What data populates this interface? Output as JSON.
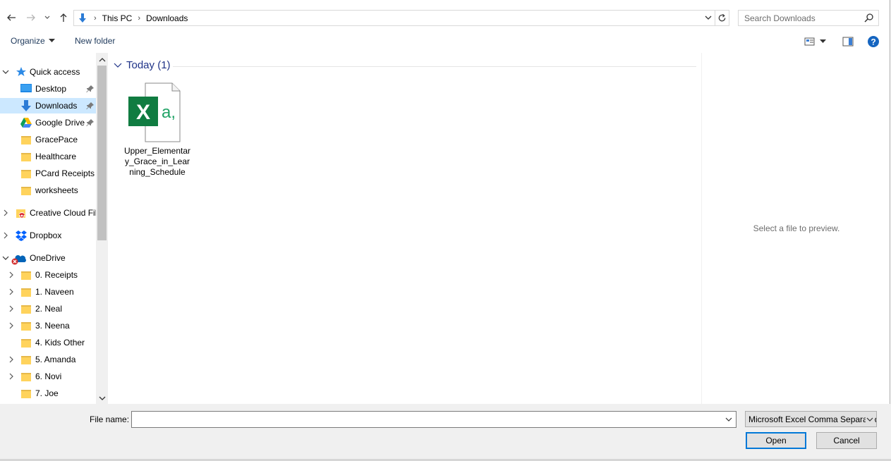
{
  "address_bar": {
    "crumbs": [
      "This PC",
      "Downloads"
    ]
  },
  "search": {
    "placeholder": "Search Downloads"
  },
  "toolbar": {
    "organize_label": "Organize",
    "new_folder_label": "New folder"
  },
  "nav_pane": {
    "items": [
      {
        "label": "Quick access",
        "icon": "star-icon"
      },
      {
        "label": "Desktop",
        "icon": "desktop-icon",
        "pinned": true
      },
      {
        "label": "Downloads",
        "icon": "download-arrow-icon",
        "pinned": true,
        "selected": true
      },
      {
        "label": "Google Drive",
        "icon": "google-drive-icon",
        "pinned": true
      },
      {
        "label": "GracePace",
        "icon": "folder-icon"
      },
      {
        "label": "Healthcare",
        "icon": "folder-icon"
      },
      {
        "label": "PCard Receipts",
        "icon": "folder-icon"
      },
      {
        "label": "worksheets",
        "icon": "folder-icon"
      },
      {
        "label": "Creative Cloud Fil",
        "icon": "creative-cloud-icon"
      },
      {
        "label": "Dropbox",
        "icon": "dropbox-icon"
      },
      {
        "label": "OneDrive",
        "icon": "onedrive-icon"
      },
      {
        "label": "0.  Receipts",
        "icon": "folder-icon"
      },
      {
        "label": "1. Naveen",
        "icon": "folder-icon"
      },
      {
        "label": "2. Neal",
        "icon": "folder-icon"
      },
      {
        "label": "3. Neena",
        "icon": "folder-icon"
      },
      {
        "label": "4.  Kids Other",
        "icon": "folder-icon"
      },
      {
        "label": "5.  Amanda",
        "icon": "folder-icon"
      },
      {
        "label": "6.  Novi",
        "icon": "folder-icon"
      },
      {
        "label": "7.  Joe",
        "icon": "folder-icon"
      }
    ]
  },
  "content": {
    "group_header": "Today (1)",
    "files": [
      {
        "name": "Upper_Elementary_Grace_in_Learning_Schedule",
        "icon": "excel-csv-file-icon"
      }
    ]
  },
  "preview": {
    "message": "Select a file to preview."
  },
  "bottom": {
    "file_name_label": "File name:",
    "file_name_value": "",
    "file_type_value": "Microsoft Excel Comma Separated Values File",
    "open_label": "Open",
    "cancel_label": "Cancel"
  },
  "colors": {
    "selection": "#cce8ff",
    "accent": "#0078d7",
    "group_header": "#1e3287",
    "excel_green": "#107c41"
  }
}
